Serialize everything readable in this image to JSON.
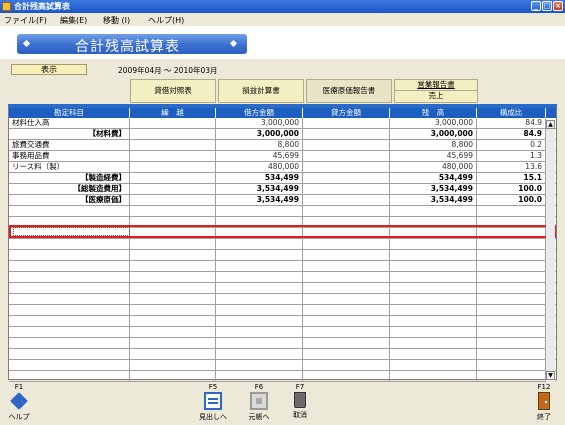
{
  "window": {
    "title": "合計残高試算表"
  },
  "menu": [
    {
      "label": "ファイル(F)"
    },
    {
      "label": "編集(E)"
    },
    {
      "label": "移動 (I)"
    },
    {
      "label": "ヘルプ(H)"
    }
  ],
  "banner": {
    "title": "合計残高試算表"
  },
  "toolbar": {
    "display_label": "表示",
    "period": "2009年04月 ～ 2010年03月"
  },
  "tabs": [
    {
      "label": "貸借対照表"
    },
    {
      "label": "損益計算書"
    },
    {
      "label": "医療原価報告書"
    },
    {
      "label": "営業報告書"
    },
    {
      "label": "売上"
    }
  ],
  "table": {
    "headers": [
      "勘定科目",
      "繰　越",
      "借方金額",
      "貸方金額",
      "残　高",
      "構成比"
    ],
    "rows": [
      {
        "account": "材料仕入高",
        "carry": "",
        "debit": "3,000,000",
        "credit": "",
        "balance": "3,000,000",
        "ratio": "84.9",
        "bold": false
      },
      {
        "account": "【材料費】",
        "carry": "",
        "debit": "3,000,000",
        "credit": "",
        "balance": "3,000,000",
        "ratio": "84.9",
        "bold": true
      },
      {
        "account": "旅費交通費",
        "carry": "",
        "debit": "8,800",
        "credit": "",
        "balance": "8,800",
        "ratio": "0.2",
        "bold": false
      },
      {
        "account": "事務用品費",
        "carry": "",
        "debit": "45,699",
        "credit": "",
        "balance": "45,699",
        "ratio": "1.3",
        "bold": false
      },
      {
        "account": "リース料（製）",
        "carry": "",
        "debit": "480,000",
        "credit": "",
        "balance": "480,000",
        "ratio": "13.6",
        "bold": false
      },
      {
        "account": "【製造経費】",
        "carry": "",
        "debit": "534,499",
        "credit": "",
        "balance": "534,499",
        "ratio": "15.1",
        "bold": true
      },
      {
        "account": "【総製造費用】",
        "carry": "",
        "debit": "3,534,499",
        "credit": "",
        "balance": "3,534,499",
        "ratio": "100.0",
        "bold": true
      },
      {
        "account": "【医療原価】",
        "carry": "",
        "debit": "3,534,499",
        "credit": "",
        "balance": "3,534,499",
        "ratio": "100.0",
        "bold": true
      }
    ]
  },
  "fkeys": [
    {
      "key": "F1",
      "label": "ヘルプ"
    },
    {
      "key": "F5",
      "label": "見出しへ"
    },
    {
      "key": "F6",
      "label": "元帳へ"
    },
    {
      "key": "F7",
      "label": "取消"
    },
    {
      "key": "F12",
      "label": "終了"
    }
  ]
}
